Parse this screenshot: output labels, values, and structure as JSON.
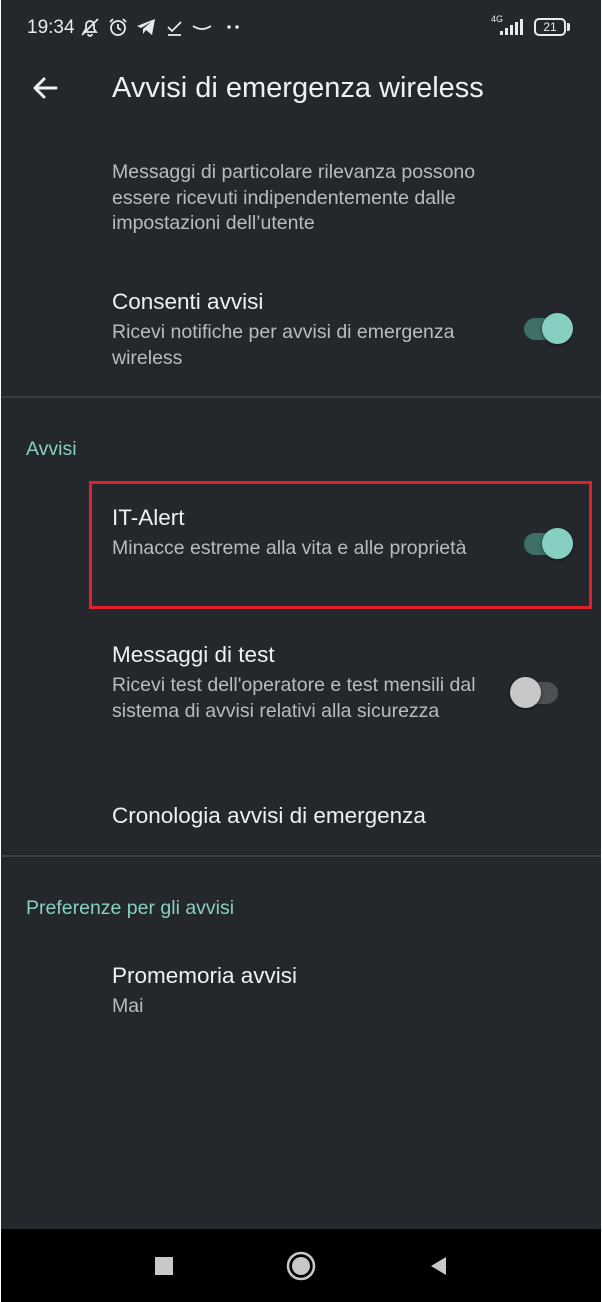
{
  "status_bar": {
    "time": "19:34",
    "network": "4G",
    "battery": "21",
    "icons": [
      "mute-bell-icon",
      "alarm-icon",
      "telegram-icon",
      "check-icon",
      "wave-icon",
      "more-dots-icon",
      "signal-icon",
      "battery-icon"
    ]
  },
  "app_bar": {
    "title": "Avvisi di emergenza wireless",
    "back_icon": "back-arrow-icon"
  },
  "intro": {
    "description": "Messaggi di particolare rilevanza possono essere ricevuti indipendentemente dalle impostazioni dell’utente"
  },
  "allow_alerts": {
    "title": "Consenti avvisi",
    "summary": "Ricevi notifiche per avvisi di emergenza wireless",
    "enabled": true
  },
  "section_alerts": {
    "header": "Avvisi",
    "it_alert": {
      "title": "IT-Alert",
      "summary": "Minacce estreme alla vita e alle proprietà",
      "enabled": true
    },
    "test_messages": {
      "title": "Messaggi di test",
      "summary": "Ricevi test dell'operatore e test mensili dal sistema di avvisi relativi alla sicurezza",
      "enabled": false
    },
    "history": {
      "title": "Cronologia avvisi di emergenza"
    }
  },
  "section_preferences": {
    "header": "Preferenze per gli avvisi",
    "reminder": {
      "title": "Promemoria avvisi",
      "summary": "Mai"
    }
  },
  "colors": {
    "background": "#24282c",
    "accent": "#86cfc2",
    "highlight": "#e0202a"
  },
  "nav_bar": {
    "icons": [
      "recents-square-icon",
      "home-circle-icon",
      "back-triangle-icon"
    ]
  }
}
